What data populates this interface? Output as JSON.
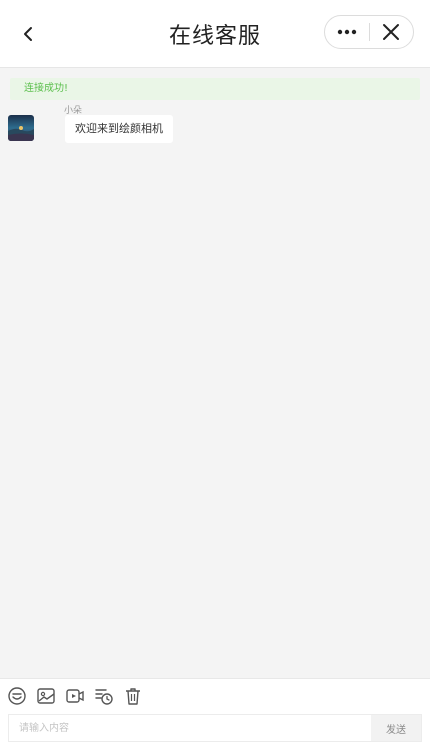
{
  "header": {
    "title": "在线客服",
    "back_icon": "chevron-left-icon",
    "more_icon": "more-dots-icon",
    "close_icon": "close-icon"
  },
  "chat": {
    "notice": "连接成功!",
    "messages": [
      {
        "sender": "小朵",
        "text": "欢迎来到绘颜相机",
        "avatar": "avatar-image"
      }
    ]
  },
  "toolbar": {
    "icons": [
      "emoji-icon",
      "image-icon",
      "video-icon",
      "history-icon",
      "trash-icon"
    ],
    "input_placeholder": "请输入内容",
    "input_value": "",
    "send_label": "发送"
  },
  "colors": {
    "notice_bg": "#eaf6e7",
    "notice_text": "#5bbf4c",
    "chat_bg": "#f4f4f4"
  }
}
